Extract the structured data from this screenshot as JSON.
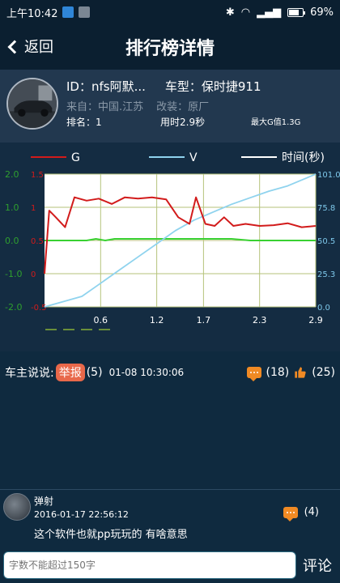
{
  "status_bar": {
    "time": "上午10:42",
    "battery": "69%",
    "icons": [
      "upload-icon",
      "image-icon",
      "bluetooth-icon",
      "wifi-icon",
      "signal-icon",
      "battery-icon"
    ]
  },
  "nav": {
    "back_label": "返回",
    "title": "排行榜详情"
  },
  "profile": {
    "id_text": "ID：nfs阿默...",
    "car_model": "车型：保时捷911",
    "origin": "来自：中国.江苏",
    "modification": "改装：原厂",
    "rank": "排名：1",
    "time_used": "用时2.9秒",
    "max_g": "最大G值1.3G"
  },
  "chart_data": {
    "type": "line",
    "legend": [
      "G",
      "V",
      "时间(秒)"
    ],
    "colors": {
      "G": "#d21b1b",
      "V": "#8fd3ee",
      "green": "#39d132",
      "left_axis_green": "#2f9f2f",
      "right_axis": "#7ec8ea"
    },
    "x_ticks": [
      "0.6",
      "1.2",
      "1.7",
      "2.3",
      "2.9"
    ],
    "left_axis_red_ticks": [
      "1.5",
      "1",
      "0.5",
      "0",
      "-0.5"
    ],
    "left_axis_green_ticks": [
      "2.0",
      "1.0",
      "0.0",
      "-1.0",
      "-2.0"
    ],
    "right_axis_ticks": [
      "101.0",
      "75.8",
      "50.5",
      "25.3",
      "0.0"
    ],
    "xlim": [
      0,
      2.9
    ],
    "series": [
      {
        "name": "G",
        "x": [
          0.0,
          0.05,
          0.12,
          0.22,
          0.32,
          0.45,
          0.58,
          0.72,
          0.86,
          1.0,
          1.15,
          1.3,
          1.43,
          1.55,
          1.62,
          1.72,
          1.82,
          1.92,
          2.02,
          2.15,
          2.3,
          2.45,
          2.6,
          2.75,
          2.9
        ],
        "y": [
          0.0,
          0.95,
          0.85,
          0.7,
          1.15,
          1.1,
          1.13,
          1.05,
          1.15,
          1.13,
          1.15,
          1.12,
          0.85,
          0.75,
          1.15,
          0.75,
          0.72,
          0.85,
          0.72,
          0.75,
          0.72,
          0.73,
          0.76,
          0.7,
          0.72
        ],
        "ylim": [
          -0.5,
          1.5
        ]
      },
      {
        "name": "V",
        "x": [
          0.0,
          0.2,
          0.4,
          0.6,
          0.8,
          1.0,
          1.2,
          1.4,
          1.6,
          1.8,
          2.0,
          2.2,
          2.4,
          2.6,
          2.8,
          2.9
        ],
        "y": [
          0.0,
          4.0,
          8.0,
          18.0,
          28.0,
          38.0,
          48.0,
          58.0,
          66.0,
          72.0,
          78.0,
          83.0,
          88.0,
          92.0,
          98.0,
          101.0
        ],
        "ylim": [
          0,
          101
        ]
      },
      {
        "x": [
          0.0,
          0.45,
          0.55,
          0.65,
          0.75,
          1.0,
          1.5,
          2.0,
          2.2,
          2.4,
          2.6,
          2.9
        ],
        "y": [
          0.0,
          0.0,
          0.05,
          0.0,
          0.05,
          0.05,
          0.05,
          0.05,
          0.0,
          0.0,
          0.0,
          0.0
        ],
        "ylim": [
          -2.0,
          2.0
        ]
      }
    ]
  },
  "comment_header": {
    "prefix": "车主说说:",
    "report_label": "举报",
    "count": "(5)",
    "datetime": "01-08 10:30:06",
    "comment_count": "(18)",
    "like_count": "(25)"
  },
  "user_comment": {
    "name": "弹射",
    "datetime": "2016-01-17 22:56:12",
    "text": "这个软件也就pp玩玩的 有啥意思",
    "reply_count": "(4)"
  },
  "input": {
    "placeholder": "字数不能超过150字",
    "submit_label": "评论"
  }
}
